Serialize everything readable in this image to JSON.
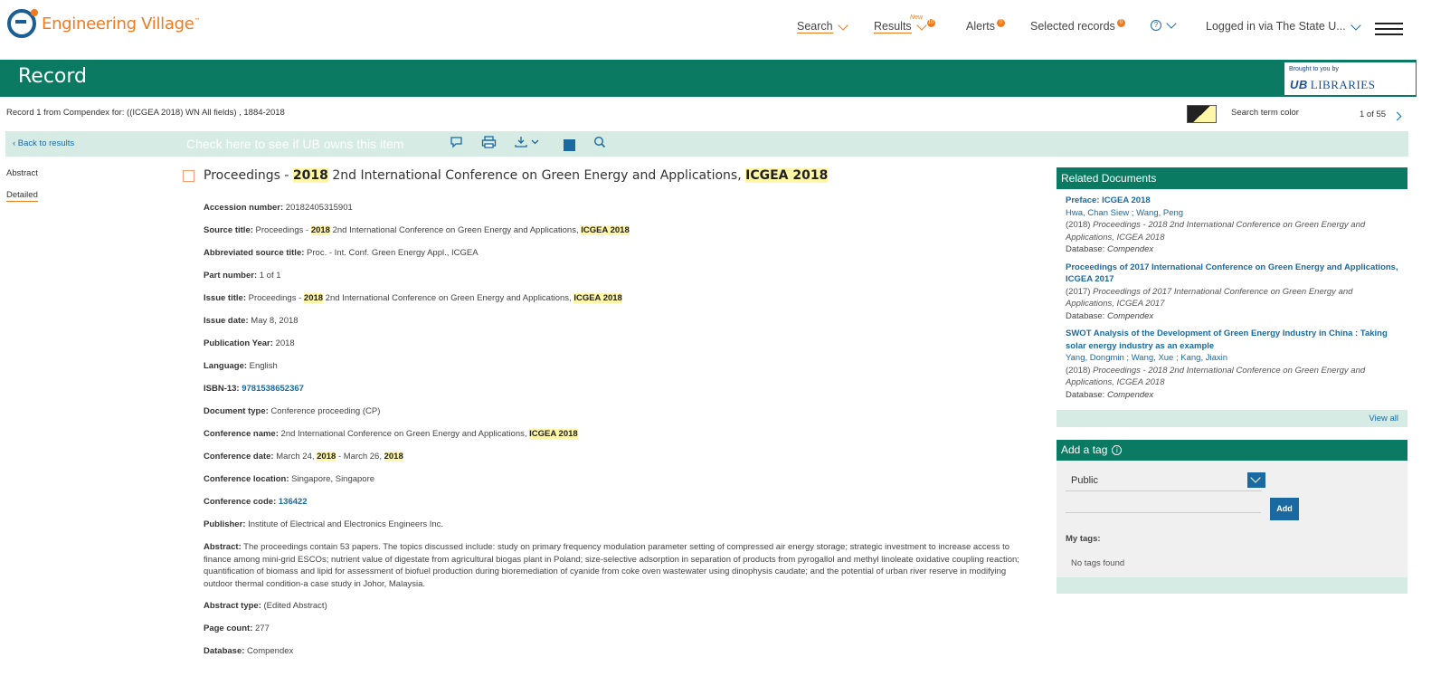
{
  "app": {
    "brand": "Engineering Village",
    "tm": "™"
  },
  "nav": {
    "search": "Search",
    "results": "Results",
    "results_new": "New",
    "results_count": "10",
    "alerts": "Alerts",
    "alerts_count": "0",
    "selected": "Selected records",
    "selected_count": "0",
    "help": "?",
    "logged_in": "Logged in via The State U..."
  },
  "recordbar": {
    "title": "Record",
    "brought": "Brought to you by",
    "lib_ub": "UB",
    "lib_name": "LIBRARIES"
  },
  "info": {
    "record_from": "Record 1 from Compendex for: ((ICGEA 2018) WN All fields) , 1884-2018",
    "search_term_color": "Search term color",
    "pager": "1 of 55"
  },
  "toolbar": {
    "back": "‹ Back to results",
    "check_ub": "Check here to see if UB owns this item"
  },
  "left_nav": {
    "abstract": "Abstract",
    "detailed": "Detailed"
  },
  "record": {
    "title_pre": "Proceedings - ",
    "title_hl1": "2018",
    "title_mid": " 2nd International Conference on Green Energy and Applications, ",
    "title_hl2": "ICGEA 2018"
  },
  "fields": {
    "accession_k": "Accession number:",
    "accession_v": " 20182405315901",
    "source_k": "Source title:",
    "source_pre": " Proceedings - ",
    "source_hl1": "2018",
    "source_mid": " 2nd International Conference on Green Energy and Applications, ",
    "source_hl2": "ICGEA 2018",
    "abbr_k": "Abbreviated source title:",
    "abbr_v": " Proc. - Int. Conf. Green Energy Appl., ICGEA",
    "part_k": "Part number:",
    "part_v": " 1 of 1",
    "issue_k": "Issue title:",
    "issue_pre": " Proceedings - ",
    "issue_hl1": "2018",
    "issue_mid": " 2nd International Conference on Green Energy and Applications, ",
    "issue_hl2": "ICGEA 2018",
    "issuedate_k": "Issue date:",
    "issuedate_v": " May 8, 2018",
    "pubyear_k": "Publication Year:",
    "pubyear_v": " 2018",
    "lang_k": "Language:",
    "lang_v": " English",
    "isbn_k": "ISBN-13:",
    "isbn_v": "9781538652367",
    "doctype_k": "Document type:",
    "doctype_v": " Conference proceeding (CP)",
    "confname_k": "Conference name:",
    "confname_pre": " 2nd International Conference on Green Energy and Applications, ",
    "confname_hl": "ICGEA 2018",
    "confdate_k": "Conference date:",
    "confdate_pre": " March 24, ",
    "confdate_hl1": "2018",
    "confdate_mid": " - March 26, ",
    "confdate_hl2": "2018",
    "confloc_k": "Conference location:",
    "confloc_v": " Singapore, Singapore",
    "confcode_k": "Conference code:",
    "confcode_v": "136422",
    "publisher_k": "Publisher:",
    "publisher_v": " Institute of Electrical and Electronics Engineers Inc.",
    "abstract_k": "Abstract:",
    "abstract_v": " The proceedings contain 53 papers. The topics discussed include: study on primary frequency modulation parameter setting of compressed air energy storage; strategic investment to increase access to finance among mini-grid ESCOs; nutrient value of digestate from agricultural biogas plant in Poland; size-selective adsorption in separation of products from pyrogallol and methyl linoleate oxidative coupling reaction; quantification of biomass and lipid for assessment of biofuel production during bioremediation of cyanide from coke oven wastewater using dinophysis caudate; and the potential of urban river reserve in modifying outdoor thermal condition-a case study in Johor, Malaysia.",
    "abstype_k": "Abstract type:",
    "abstype_v": " (Edited Abstract)",
    "pagecount_k": "Page count:",
    "pagecount_v": " 277",
    "database_k": "Database:",
    "database_v": " Compendex"
  },
  "related": {
    "heading": "Related Documents",
    "docs": [
      {
        "title": "Preface: ICGEA 2018",
        "authors": "Hwa, Chan Siew ; Wang, Peng",
        "year": "(2018) ",
        "source": "Proceedings - 2018 2nd International Conference on Green Energy and Applications, ICGEA 2018",
        "db_label": "Database: ",
        "db": "Compendex"
      },
      {
        "title": "Proceedings of 2017 International Conference on Green Energy and Applications, ICGEA 2017",
        "authors": "",
        "year": "(2017) ",
        "source": "Proceedings of 2017 International Conference on Green Energy and Applications, ICGEA 2017",
        "db_label": "Database: ",
        "db": "Compendex"
      },
      {
        "title": "SWOT Analysis of the Development of Green Energy Industry in China : Taking solar energy industry as an example",
        "authors": "Yang, Dongmin ; Wang, Xue ; Kang, Jiaxin",
        "year": "(2018) ",
        "source": "Proceedings - 2018 2nd International Conference on Green Energy and Applications, ICGEA 2018",
        "db_label": "Database: ",
        "db": "Compendex"
      }
    ],
    "view_all": "View all"
  },
  "tags": {
    "heading": "Add a tag",
    "select_value": "Public",
    "add": "Add",
    "my_tags": "My tags:",
    "no_tags": "No tags found"
  },
  "colors": {
    "brand_orange": "#f07b1f",
    "brand_green": "#0a7a63",
    "link_blue": "#1a6aa1",
    "highlight": "#fff6a8"
  }
}
